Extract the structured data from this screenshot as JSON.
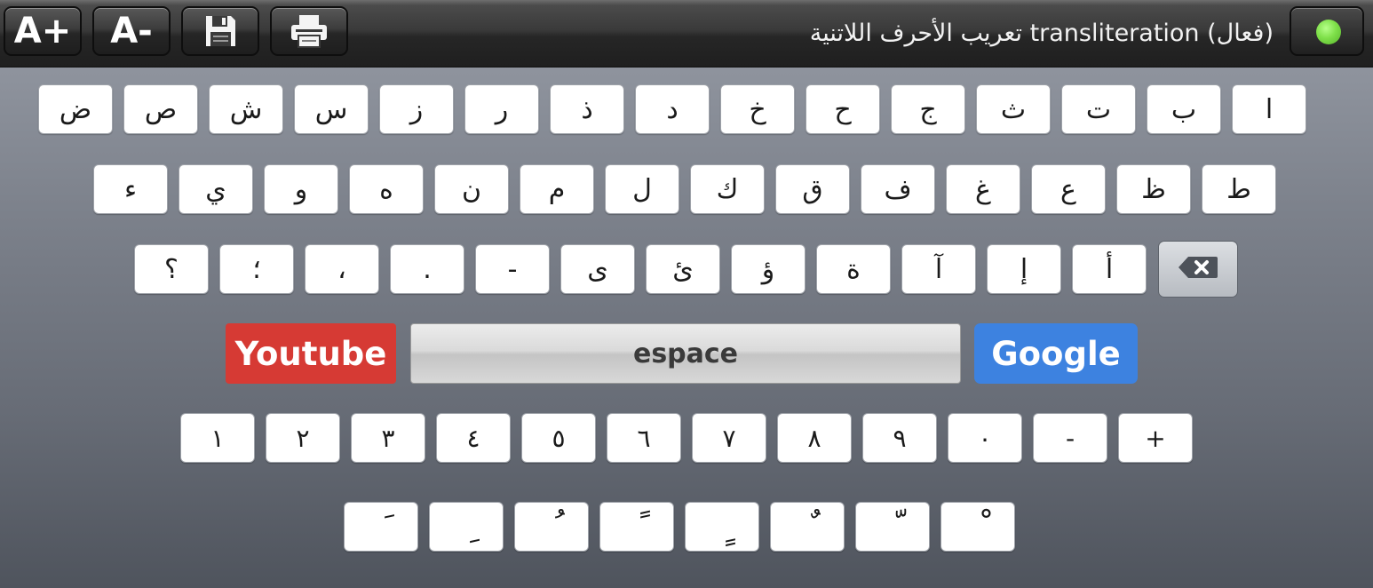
{
  "toolbar": {
    "font_increase_label": "A+",
    "font_decrease_label": "A-",
    "save_icon": "floppy-disk-icon",
    "print_icon": "printer-icon",
    "title": "تعريب الأحرف اللاتنية transliteration (فعال)",
    "status_color": "#7fe04a"
  },
  "keyboard": {
    "row1": [
      "ض",
      "ص",
      "ش",
      "س",
      "ز",
      "ر",
      "ذ",
      "د",
      "خ",
      "ح",
      "ج",
      "ث",
      "ت",
      "ب",
      "ا"
    ],
    "row2": [
      "ء",
      "ي",
      "و",
      "ه",
      "ن",
      "م",
      "ل",
      "ك",
      "ق",
      "ف",
      "غ",
      "ع",
      "ظ",
      "ط"
    ],
    "row3": [
      "؟",
      "؛",
      "،",
      ".",
      "-",
      "ى",
      "ئ",
      "ؤ",
      "ة",
      "آ",
      "إ",
      "أ"
    ],
    "backspace_icon": "backspace-icon",
    "youtube_label": "Youtube",
    "space_label": "espace",
    "google_label": "Google",
    "numbers": [
      "١",
      "٢",
      "٣",
      "٤",
      "٥",
      "٦",
      "٧",
      "٨",
      "٩",
      "٠",
      "-",
      "+"
    ],
    "diacritics": [
      "َ",
      "ِ",
      "ُ",
      "ً",
      "ٍ",
      "ٌ",
      "ّ",
      "ْ"
    ]
  },
  "colors": {
    "youtube": "#d63a34",
    "google": "#3d82e0"
  }
}
